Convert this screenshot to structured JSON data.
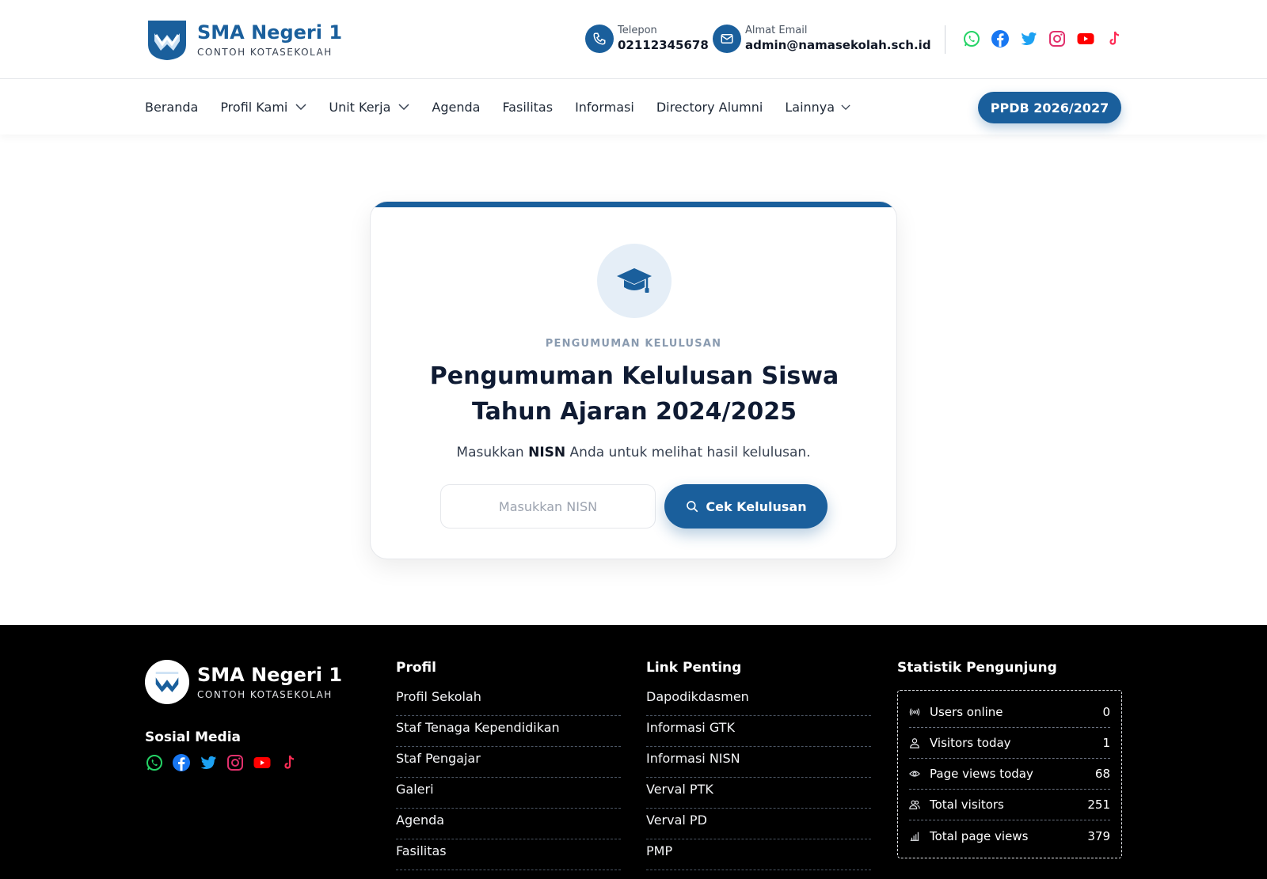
{
  "header": {
    "school_name": "SMA Negeri 1",
    "school_sub": "CONTOH KOTASEKOLAH",
    "phone_label": "Telepon",
    "phone_value": "02112345678",
    "email_label": "Almat Email",
    "email_value": "admin@namasekolah.sch.id",
    "socials": [
      "whatsapp-icon",
      "facebook-icon",
      "twitter-icon",
      "instagram-icon",
      "youtube-icon",
      "tiktok-icon"
    ]
  },
  "nav": {
    "items": [
      {
        "label": "Beranda",
        "dropdown": false
      },
      {
        "label": "Profil Kami",
        "dropdown": true
      },
      {
        "label": "Unit Kerja",
        "dropdown": true
      },
      {
        "label": "Agenda",
        "dropdown": false
      },
      {
        "label": "Fasilitas",
        "dropdown": false
      },
      {
        "label": "Informasi",
        "dropdown": false
      },
      {
        "label": "Directory Alumni",
        "dropdown": false
      },
      {
        "label": "Lainnya",
        "dropdown": true
      }
    ],
    "cta_label": "PPDB 2026/2027"
  },
  "card": {
    "eyebrow": "PENGUMUMAN KELULUSAN",
    "title": "Pengumuman Kelulusan Siswa Tahun Ajaran 2024/2025",
    "desc_before": "Masukkan ",
    "desc_bold": "NISN",
    "desc_after": " Anda untuk melihat hasil kelulusan.",
    "input_placeholder": "Masukkan NISN",
    "input_value": "",
    "button_label": "Cek Kelulusan"
  },
  "footer": {
    "school_name": "SMA Negeri 1",
    "school_sub": "CONTOH KOTASEKOLAH",
    "social_title": "Sosial Media",
    "profil_title": "Profil",
    "profil_links": [
      "Profil Sekolah",
      "Staf Tenaga Kependidikan",
      "Staf Pengajar",
      "Galeri",
      "Agenda",
      "Fasilitas"
    ],
    "link_title": "Link Penting",
    "link_links": [
      "Dapodikdasmen",
      "Informasi GTK",
      "Informasi NISN",
      "Verval PTK",
      "Verval PD",
      "PMP"
    ],
    "stat_title": "Statistik Pengunjung",
    "stats": [
      {
        "label": "Users online",
        "value": "0",
        "icon": "broadcast-icon"
      },
      {
        "label": "Visitors today",
        "value": "1",
        "icon": "user-icon"
      },
      {
        "label": "Page views today",
        "value": "68",
        "icon": "eye-icon"
      },
      {
        "label": "Total visitors",
        "value": "251",
        "icon": "users-icon"
      },
      {
        "label": "Total page views",
        "value": "379",
        "icon": "bar-chart-icon"
      }
    ]
  },
  "colors": {
    "brand": "#1a5f9c",
    "whatsapp": "#25d366",
    "facebook": "#1877f2",
    "twitter": "#1da1f2",
    "instagram": "#e1306c",
    "youtube": "#ff0000",
    "tiktok": "#fe2c55"
  }
}
